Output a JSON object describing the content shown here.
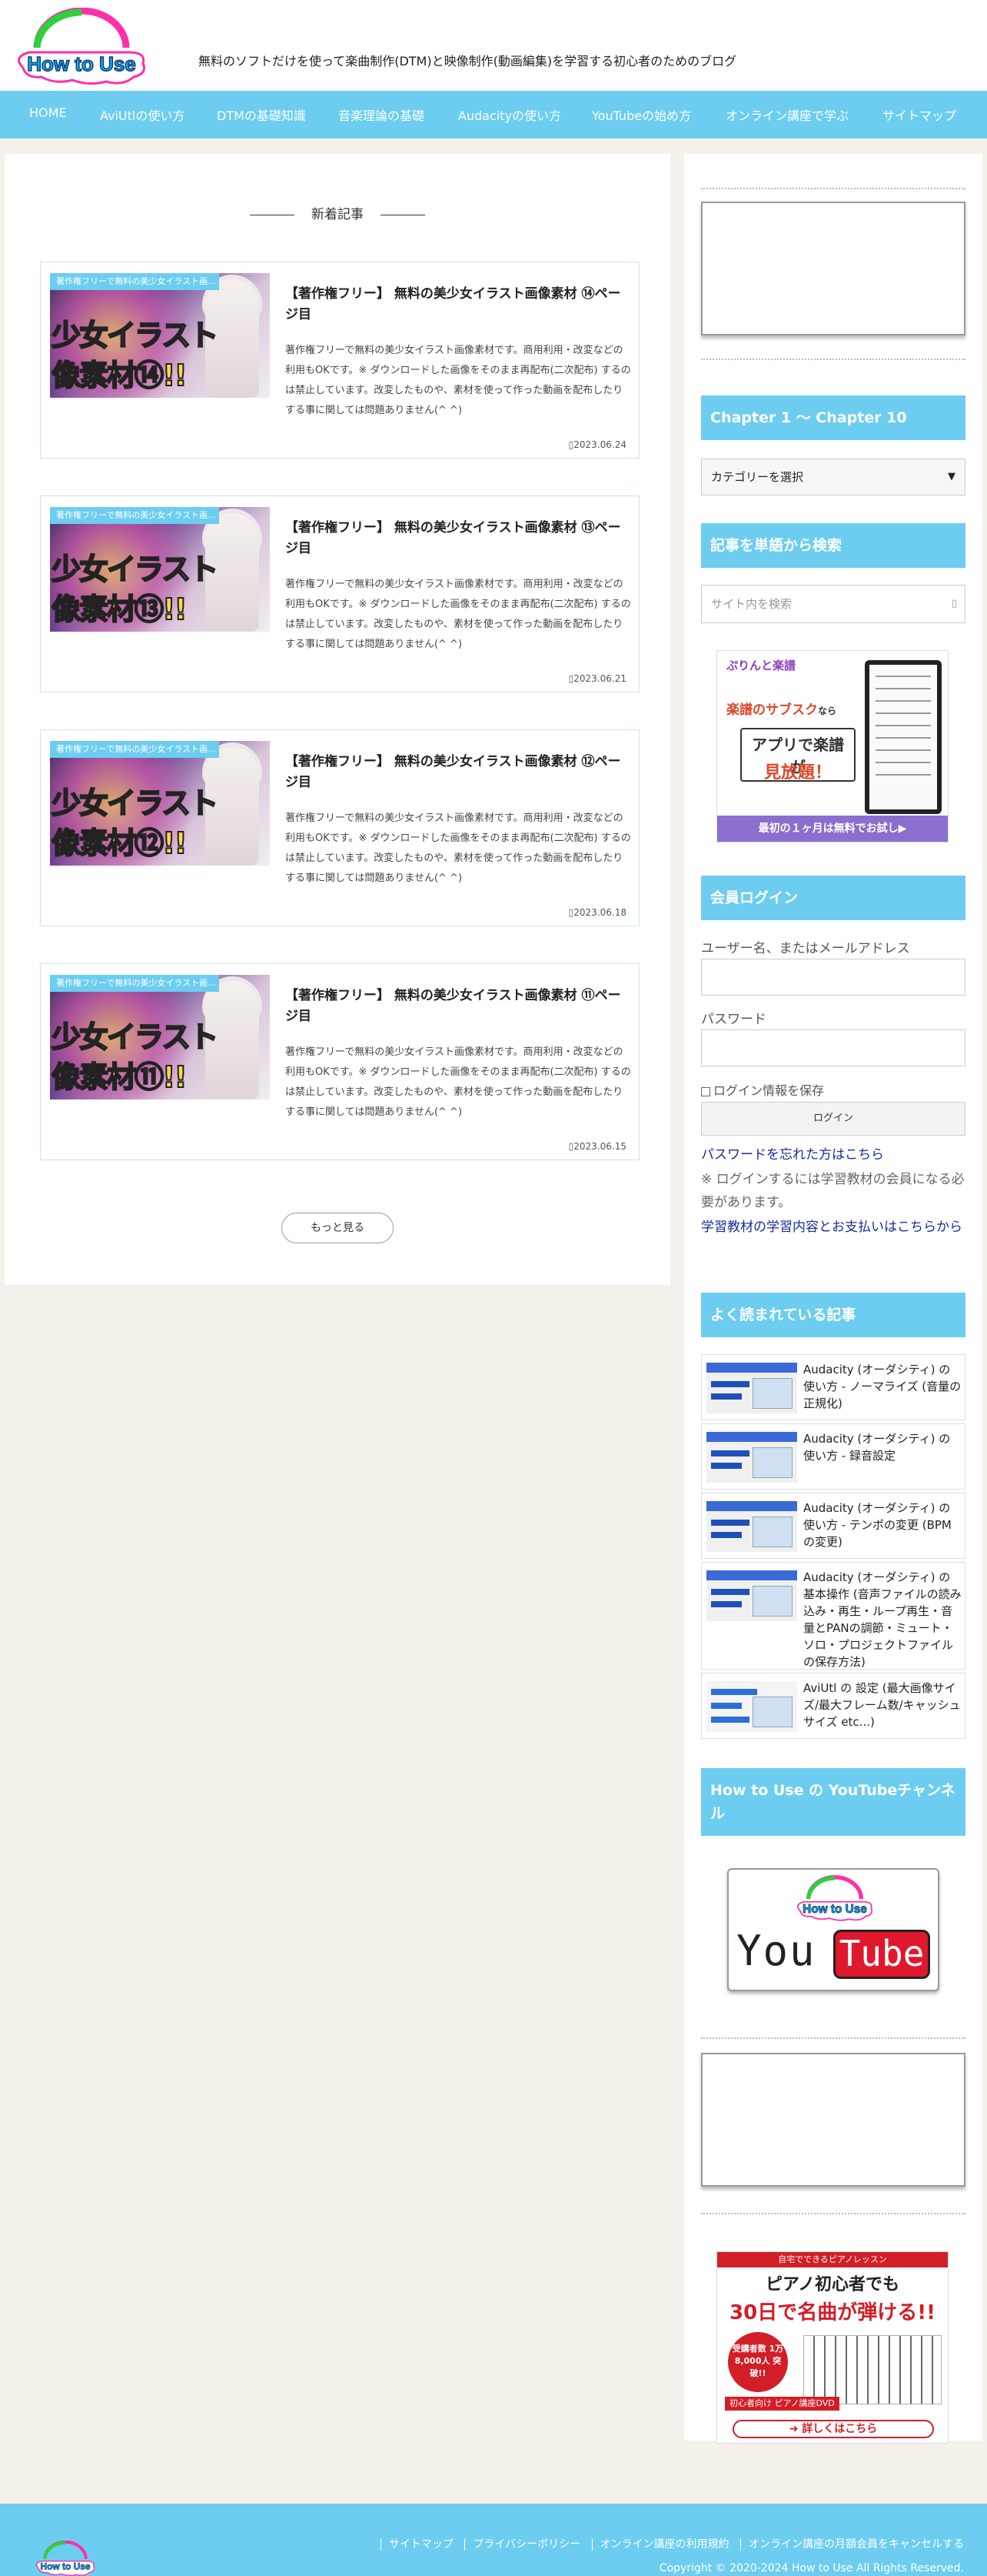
{
  "header": {
    "logo_text": "How to Use",
    "tagline": "無料のソフトだけを使って楽曲制作(DTM)と映像制作(動画編集)を学習する初心者のためのブログ"
  },
  "nav": {
    "items": [
      {
        "label": "HOME"
      },
      {
        "label": "AviUtlの使い方"
      },
      {
        "label": "DTMの基礎知識"
      },
      {
        "label": "音楽理論の基礎"
      },
      {
        "label": "Audacityの使い方"
      },
      {
        "label": "YouTubeの始め方"
      },
      {
        "label": "オンライン講座で学ぶ"
      },
      {
        "label": "サイトマップ"
      }
    ]
  },
  "main": {
    "section_title": "新着記事",
    "articles": [
      {
        "category": "著作権フリーで無料の美少女イラスト画...",
        "thumb_line1": "少女イラスト",
        "thumb_line2": "像素材⑭!!",
        "title": "【著作権フリー】 無料の美少女イラスト画像素材 ⑭ページ目",
        "excerpt": "著作権フリーで無料の美少女イラスト画像素材です。商用利用・改変などの利用もOKです。※ ダウンロードした画像をそのまま再配布(二次配布) するのは禁止しています。改変したものや、素材を使って作った動画を配布したりする事に関しては問題ありません(^ ^)",
        "date": "2023.06.24"
      },
      {
        "category": "著作権フリーで無料の美少女イラスト画...",
        "thumb_line1": "少女イラスト",
        "thumb_line2": "像素材⑬!!",
        "title": "【著作権フリー】 無料の美少女イラスト画像素材 ⑬ページ目",
        "excerpt": "著作権フリーで無料の美少女イラスト画像素材です。商用利用・改変などの利用もOKです。※ ダウンロードした画像をそのまま再配布(二次配布) するのは禁止しています。改変したものや、素材を使って作った動画を配布したりする事に関しては問題ありません(^ ^)",
        "date": "2023.06.21"
      },
      {
        "category": "著作権フリーで無料の美少女イラスト画...",
        "thumb_line1": "少女イラスト",
        "thumb_line2": "像素材⑫!!",
        "title": "【著作権フリー】 無料の美少女イラスト画像素材 ⑫ページ目",
        "excerpt": "著作権フリーで無料の美少女イラスト画像素材です。商用利用・改変などの利用もOKです。※ ダウンロードした画像をそのまま再配布(二次配布) するのは禁止しています。改変したものや、素材を使って作った動画を配布したりする事に関しては問題ありません(^ ^)",
        "date": "2023.06.18"
      },
      {
        "category": "著作権フリーで無料の美少女イラスト画...",
        "thumb_line1": "少女イラスト",
        "thumb_line2": "像素材⑪!!",
        "title": "【著作権フリー】 無料の美少女イラスト画像素材 ⑪ページ目",
        "excerpt": "著作権フリーで無料の美少女イラスト画像素材です。商用利用・改変などの利用もOKです。※ ダウンロードした画像をそのまま再配布(二次配布) するのは禁止しています。改変したものや、素材を使って作った動画を配布したりする事に関しては問題ありません(^ ^)",
        "date": "2023.06.15"
      }
    ],
    "more_label": "もっと見る"
  },
  "sidebar": {
    "chapter_title": "Chapter 1 〜 Chapter 10",
    "category_select": "カテゴリーを選択",
    "search_title": "記事を単語から検索",
    "search_placeholder": "サイト内を検索",
    "sheet_ad": {
      "brand": "ぷりんと楽譜",
      "line1": "楽譜のサブスク",
      "line1_suffix": "なら",
      "line2": "アプリで楽譜が",
      "line3": "見放題！",
      "footer": "最初の１ヶ月は無料でお試し▶"
    },
    "login": {
      "title": "会員ログイン",
      "username_label": "ユーザー名、またはメールアドレス",
      "password_label": "パスワード",
      "remember_label": "ログイン情報を保存",
      "login_button": "ログイン",
      "forgot_link": "パスワードを忘れた方はこちら",
      "note": "※ ログインするには学習教材の会員になる必要があります。",
      "support_link": "学習教材の学習内容とお支払いはこちらから"
    },
    "popular": {
      "title": "よく読まれている記事",
      "items": [
        {
          "title": "Audacity (オーダシティ) の使い方 - ノーマライズ (音量の正規化)"
        },
        {
          "title": "Audacity (オーダシティ) の使い方 - 録音設定"
        },
        {
          "title": "Audacity (オーダシティ) の使い方 - テンポの変更 (BPMの変更)"
        },
        {
          "title": "Audacity (オーダシティ) の基本操作 (音声ファイルの読み込み・再生・ループ再生・音量とPANの調節・ミュート・ソロ・プロジェクトファイルの保存方法)"
        },
        {
          "title": "AviUtl の 設定 (最大画像サイズ/最大フレーム数/キャッシュサイズ etc...)"
        }
      ]
    },
    "youtube": {
      "title": "How to Use の YouTubeチャンネル",
      "you": "You",
      "tube": "Tube",
      "logo_text": "How to Use"
    },
    "piano_ad": {
      "top": "自宅でできるピアノレッスン",
      "line1": "ピアノ初心者でも",
      "line2": "30日で名曲が弾ける!!",
      "badge": "受講者数 1万8,000人 突破!!",
      "dvd": "初心者向け ピアノ講座DVD",
      "cta": "➜ 詳しくはこちら"
    }
  },
  "footer": {
    "links": [
      "サイトマップ",
      "プライバシーポリシー",
      "オンライン講座の利用規約",
      "オンライン講座の月額会員をキャンセルする"
    ],
    "copyright": "Copyright © 2020-2024 How to Use All Rights Reserved.",
    "logo_text": "How to Use"
  },
  "colors": {
    "accent": "#6ccdf0",
    "background": "#f4f1ea",
    "link": "#1a2a9a"
  }
}
